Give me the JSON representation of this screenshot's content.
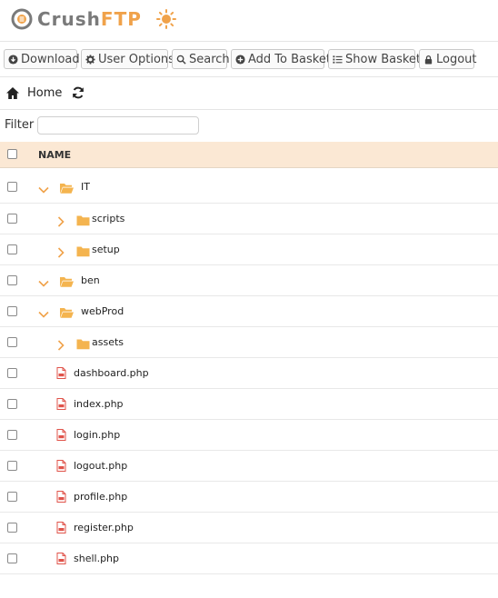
{
  "app": {
    "logo_text_a": "Crush",
    "logo_text_b": "FTP",
    "theme_icon": "sun-icon"
  },
  "toolbar": {
    "buttons": [
      {
        "label": "Download",
        "icon": "download-icon"
      },
      {
        "label": "User Options",
        "icon": "gear-icon"
      },
      {
        "label": "Search",
        "icon": "search-icon"
      },
      {
        "label": "Add To Basket",
        "icon": "plus-icon"
      },
      {
        "label": "Show Basket",
        "icon": "list-icon"
      },
      {
        "label": "Logout",
        "icon": "lock-icon"
      }
    ]
  },
  "breadcrumb": {
    "home_label": "Home",
    "home_icon": "home-icon",
    "refresh_icon": "refresh-icon"
  },
  "filter": {
    "label": "Filter",
    "value": "",
    "placeholder": ""
  },
  "table": {
    "header_name": "NAME",
    "rows": [
      {
        "name": "IT",
        "type": "folder",
        "expanded": true,
        "depth": 0
      },
      {
        "name": "scripts",
        "type": "folder",
        "expanded": false,
        "depth": 1
      },
      {
        "name": "setup",
        "type": "folder",
        "expanded": false,
        "depth": 1
      },
      {
        "name": "ben",
        "type": "folder",
        "expanded": true,
        "depth": 0
      },
      {
        "name": "webProd",
        "type": "folder",
        "expanded": true,
        "depth": 0
      },
      {
        "name": "assets",
        "type": "folder",
        "expanded": false,
        "depth": 1
      },
      {
        "name": "dashboard.php",
        "type": "file",
        "depth": 1
      },
      {
        "name": "index.php",
        "type": "file",
        "depth": 1
      },
      {
        "name": "login.php",
        "type": "file",
        "depth": 1
      },
      {
        "name": "logout.php",
        "type": "file",
        "depth": 1
      },
      {
        "name": "profile.php",
        "type": "file",
        "depth": 1
      },
      {
        "name": "register.php",
        "type": "file",
        "depth": 1
      },
      {
        "name": "shell.php",
        "type": "file",
        "depth": 1
      }
    ]
  },
  "colors": {
    "accent": "#f0a24a",
    "folder": "#f4b44f",
    "file_icon": "#e0534a",
    "header_bg": "#fbe8d4"
  }
}
